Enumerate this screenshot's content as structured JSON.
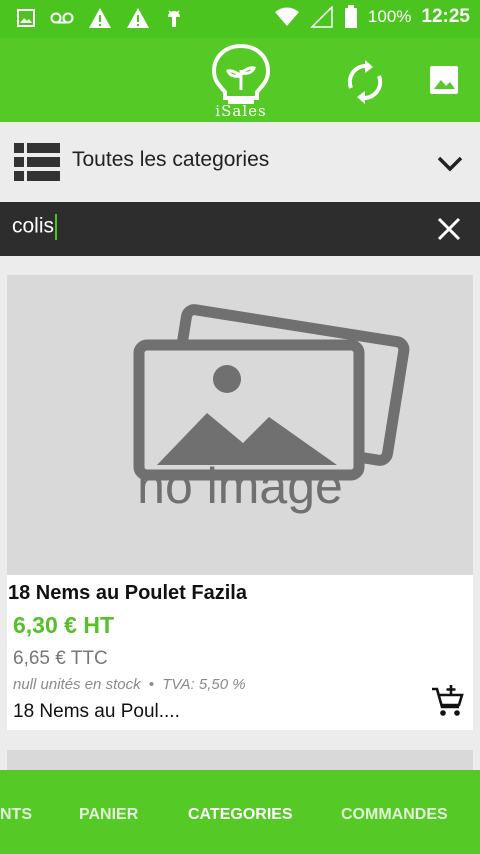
{
  "status_bar": {
    "battery": "100%",
    "time": "12:25",
    "icons": [
      "gallery-icon",
      "voicemail-icon",
      "warning-icon",
      "warning-icon",
      "android-debug-icon",
      "wifi-icon",
      "signal-icon",
      "battery-icon"
    ]
  },
  "app_bar": {
    "logo_text": "iSales",
    "actions": [
      "sync-icon",
      "gallery-icon"
    ]
  },
  "category": {
    "label": "Toutes les categories"
  },
  "search": {
    "value": "colis"
  },
  "product": {
    "image_text": "no image",
    "name": "18 Nems au Poulet Fazila",
    "price_ht": "6,30 € HT",
    "price_ttc": "6,65 € TTC",
    "stock": "null unités en stock",
    "separator": "•",
    "tva": "TVA: 5,50 %",
    "description": "18 Nems au Poul...."
  },
  "bottom_nav": {
    "tabs": [
      "NTS",
      "PANIER",
      "CATEGORIES",
      "COMMANDES"
    ],
    "active": "CATEGORIES"
  },
  "colors": {
    "primary": "#55c926",
    "status_bar": "#4cc41f",
    "price": "#55c02a",
    "search_bg": "#2d2d2d"
  }
}
